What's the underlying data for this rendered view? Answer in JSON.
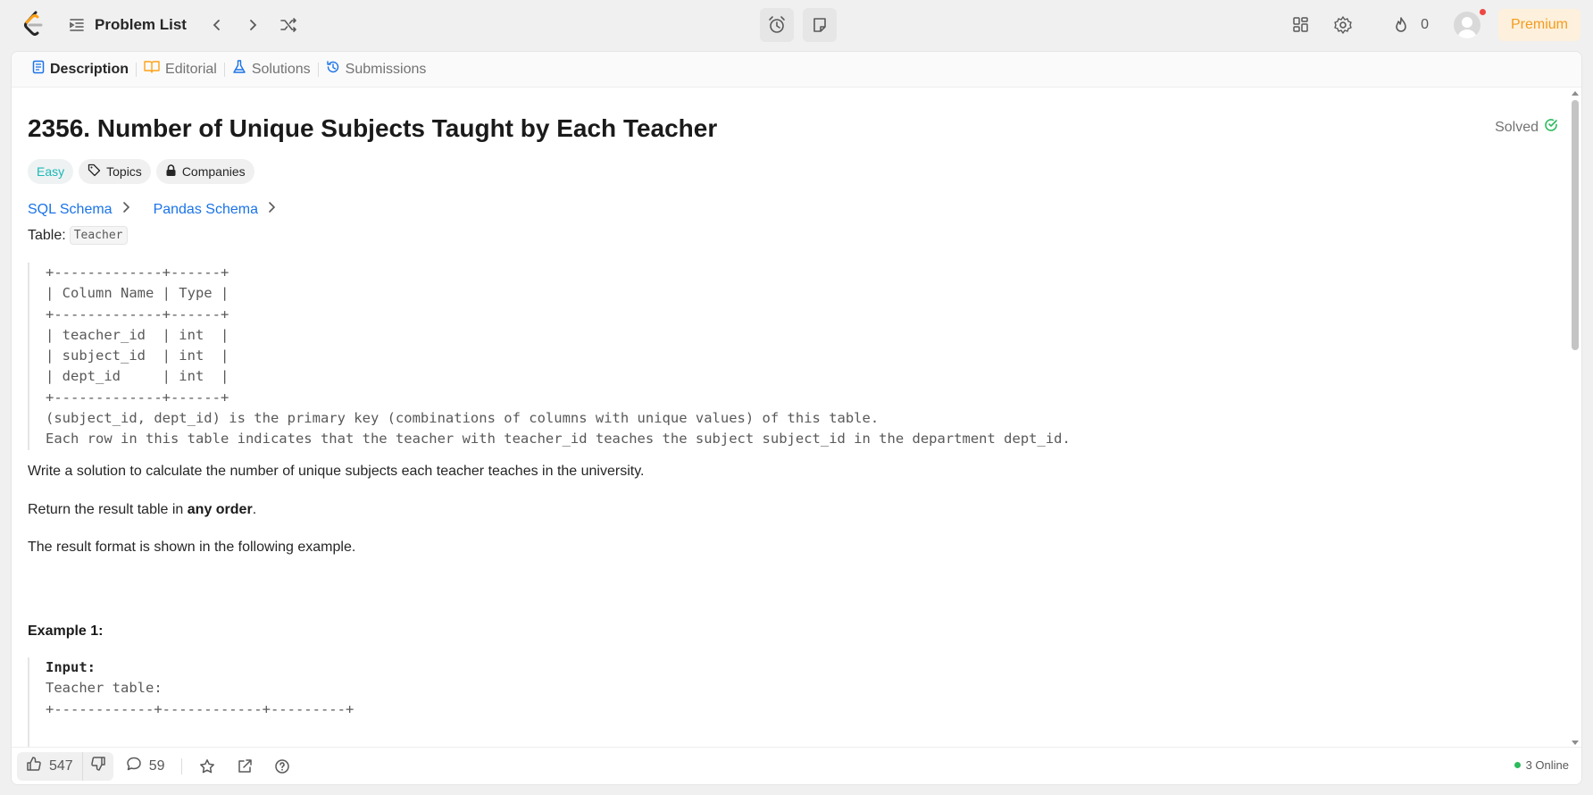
{
  "topbar": {
    "problem_list_label": "Problem List",
    "streak_count": "0",
    "premium_label": "Premium"
  },
  "tabs": [
    {
      "label": "Description",
      "active": true
    },
    {
      "label": "Editorial",
      "active": false
    },
    {
      "label": "Solutions",
      "active": false
    },
    {
      "label": "Submissions",
      "active": false
    }
  ],
  "problem": {
    "title": "2356. Number of Unique Subjects Taught by Each Teacher",
    "status": "Solved",
    "difficulty": "Easy",
    "topics_label": "Topics",
    "companies_label": "Companies",
    "sql_schema": "SQL Schema",
    "pandas_schema": "Pandas Schema",
    "table_prefix": "Table:",
    "table_name": "Teacher",
    "schema_block": "+-------------+------+\n| Column Name | Type |\n+-------------+------+\n| teacher_id  | int  |\n| subject_id  | int  |\n| dept_id     | int  |\n+-------------+------+\n(subject_id, dept_id) is the primary key (combinations of columns with unique values) of this table.\nEach row in this table indicates that the teacher with teacher_id teaches the subject subject_id in the department dept_id.",
    "para1": "Write a solution to calculate the number of unique subjects each teacher teaches in the university.",
    "para2_prefix": "Return the result table in ",
    "para2_bold": "any order",
    "para2_suffix": ".",
    "para3": "The result format is shown in the following example.",
    "example_title": "Example 1:",
    "example_input_label": "Input:",
    "example_table_label": "Teacher table:",
    "example_partial": "+------------+------------+---------+"
  },
  "bottombar": {
    "likes": "547",
    "comments": "59",
    "online": "3 Online"
  },
  "colors": {
    "accent_link": "#1a73e8",
    "easy": "#1cb8b8",
    "solved": "#2cbb5d",
    "premium": "#f39c1e"
  }
}
